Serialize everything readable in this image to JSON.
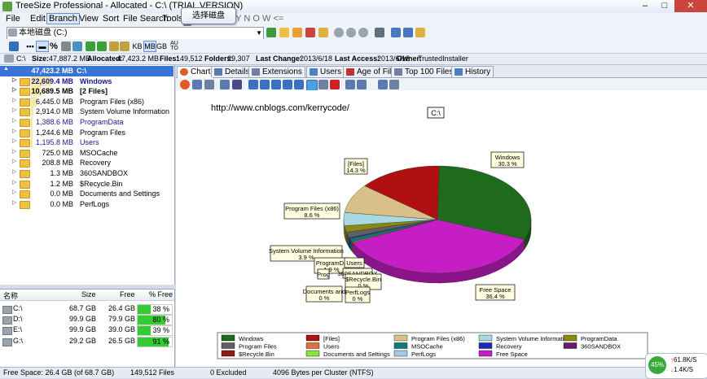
{
  "window": {
    "title": "TreeSize Professional - Allocated - C:\\  (TRIAL VERSION)",
    "controls": [
      "–",
      "□",
      "✕"
    ]
  },
  "menu": [
    "File",
    "Edit",
    "Branch",
    "View",
    "Sort",
    "File Search",
    "Tools",
    "B U Y   N O W <="
  ],
  "tooltip": "选择磁盘",
  "drive_select": {
    "value": "本地磁盘 (C:)"
  },
  "toolbar": {
    "kb": "KB",
    "mb": "MB",
    "gb": "GB",
    "auto": "AU TO",
    "pct": "%"
  },
  "infobar": {
    "path": "C:\\",
    "size_label": "Size:",
    "size": "47,887.2 MB",
    "alloc_label": "Allocated:",
    "alloc": "47,423.2 MB",
    "files_label": "Files:",
    "files": "149,512",
    "folders_label": "Folders:",
    "folders": "29,307",
    "lastchange_label": "Last Change:",
    "lastchange": "2013/6/18",
    "lastaccess_label": "Last Access:",
    "lastaccess": "2013/6/18",
    "owner_label": "Owner:",
    "owner": "TrustedInstaller"
  },
  "tree": {
    "root": {
      "size": "47,423.2 MB",
      "name": "C:\\"
    },
    "items": [
      {
        "size": "22,609.4 MB",
        "name": "Windows",
        "bold": true,
        "pct": 0.48,
        "color": "#1a1a8c"
      },
      {
        "size": "10,689.5 MB",
        "name": "[2 Files]",
        "bold": true,
        "pct": 0.23,
        "color": "#000000"
      },
      {
        "size": "6,445.0 MB",
        "name": "Program Files (x86)",
        "bold": false,
        "pct": 0.14,
        "color": "#000000"
      },
      {
        "size": "2,914.0 MB",
        "name": "System Volume Information",
        "bold": false,
        "pct": 0.06,
        "color": "#000000"
      },
      {
        "size": "1,388.6 MB",
        "name": "ProgramData",
        "bold": false,
        "pct": 0.03,
        "color": "#1a1a8c"
      },
      {
        "size": "1,244.6 MB",
        "name": "Program Files",
        "bold": false,
        "pct": 0.03,
        "color": "#000000"
      },
      {
        "size": "1,195.8 MB",
        "name": "Users",
        "bold": false,
        "pct": 0.03,
        "color": "#1a1a8c"
      },
      {
        "size": "725.0 MB",
        "name": "MSOCache",
        "bold": false,
        "pct": 0.0,
        "color": "#000000"
      },
      {
        "size": "208.8 MB",
        "name": "Recovery",
        "bold": false,
        "pct": 0.0,
        "color": "#000000"
      },
      {
        "size": "1.3 MB",
        "name": "360SANDBOX",
        "bold": false,
        "pct": 0.0,
        "color": "#000000"
      },
      {
        "size": "1.2 MB",
        "name": "$Recycle.Bin",
        "bold": false,
        "pct": 0.0,
        "color": "#000000"
      },
      {
        "size": "0.0 MB",
        "name": "Documents and Settings",
        "bold": false,
        "pct": 0.0,
        "color": "#000000"
      },
      {
        "size": "0.0 MB",
        "name": "PerfLogs",
        "bold": false,
        "pct": 0.0,
        "color": "#000000"
      }
    ]
  },
  "drivelist": {
    "headers": [
      "名称",
      "Size",
      "Free",
      "% Free"
    ],
    "rows": [
      {
        "name": "C:\\",
        "size": "68.7 GB",
        "free": "26.4 GB",
        "pct": "38 %",
        "fill": 0.38
      },
      {
        "name": "D:\\",
        "size": "99.9 GB",
        "free": "79.9 GB",
        "pct": "80 %",
        "fill": 0.8
      },
      {
        "name": "E:\\",
        "size": "99.9 GB",
        "free": "39.0 GB",
        "pct": "39 %",
        "fill": 0.39
      },
      {
        "name": "G:\\",
        "size": "29.2 GB",
        "free": "26.5 GB",
        "pct": "91 %",
        "fill": 0.91
      }
    ]
  },
  "tabs": [
    "Chart",
    "Details",
    "Extensions",
    "Users",
    "Age of Files",
    "Top 100 Files",
    "History"
  ],
  "chart_data": {
    "type": "pie",
    "url_text": "http://www.cnblogs.com/kerrycode/",
    "title": "C:\\",
    "slices": [
      {
        "name": "Windows",
        "value": 30.3,
        "label": "30.3 %",
        "color": "#1e6b1e"
      },
      {
        "name": "Free Space",
        "value": 36.4,
        "label": "36.4 %",
        "color": "#c41ec4"
      },
      {
        "name": "PerfLogs",
        "value": 0.0,
        "label": "0 %",
        "color": "#a8c8e8"
      },
      {
        "name": "Documents and Settings",
        "value": 0.0,
        "label": "0 %",
        "color": "#90e040"
      },
      {
        "name": "$Recycle.Bin",
        "value": 0.0,
        "label": "0 %",
        "color": "#8b1a1a"
      },
      {
        "name": "360SANDBOX",
        "value": 0.0,
        "label": "",
        "color": "#6a1a6a"
      },
      {
        "name": "Users",
        "value": 0.3,
        "label": "",
        "color": "#e07040"
      },
      {
        "name": "MSOCache",
        "value": 1.0,
        "label": "",
        "color": "#107878"
      },
      {
        "name": "Recovery",
        "value": 0.3,
        "label": "",
        "color": "#1a2ab4"
      },
      {
        "name": "Program Files",
        "value": 1.7,
        "label": "",
        "color": "#606060"
      },
      {
        "name": "ProgramData",
        "value": 1.9,
        "label": "",
        "color": "#8a8a10"
      },
      {
        "name": "System Volume Information",
        "value": 3.9,
        "label": "3.9 %",
        "color": "#a8d8e0"
      },
      {
        "name": "Program Files (x86)",
        "value": 8.6,
        "label": "8.6 %",
        "color": "#d8c088"
      },
      {
        "name": "[Files]",
        "value": 14.3,
        "label": "14.3 %",
        "color": "#b01010"
      }
    ],
    "callouts": [
      {
        "text": "Windows",
        "pct": "30.3 %"
      },
      {
        "text": "[Files]",
        "pct": "14.3 %"
      },
      {
        "text": "Program Files (x86)",
        "pct": "8.6 %"
      },
      {
        "text": "System Volume Information",
        "pct": "3.9 %"
      },
      {
        "text": "ProgramDa",
        "pct": "1.9 %"
      },
      {
        "text": "Prog",
        "pct": ""
      },
      {
        "text": "Users",
        "pct": ""
      },
      {
        "text": "360SANDBOX",
        "pct": ""
      },
      {
        "text": "$Recycle.Bin",
        "pct": "0 %"
      },
      {
        "text": "Documents and",
        "pct": "0 %"
      },
      {
        "text": "PerfLogs",
        "pct": "0 %"
      },
      {
        "text": "Free Space",
        "pct": "36.4 %"
      }
    ],
    "legend": [
      {
        "name": "Windows",
        "color": "#1e6b1e"
      },
      {
        "name": "[Files]",
        "color": "#b01010"
      },
      {
        "name": "Program Files (x86)",
        "color": "#d8c088"
      },
      {
        "name": "System Volume Information",
        "color": "#a8d8e0"
      },
      {
        "name": "ProgramData",
        "color": "#8a8a10"
      },
      {
        "name": "Program Files",
        "color": "#606060"
      },
      {
        "name": "Users",
        "color": "#e07040"
      },
      {
        "name": "MSOCache",
        "color": "#107878"
      },
      {
        "name": "Recovery",
        "color": "#1a2ab4"
      },
      {
        "name": "360SANDBOX",
        "color": "#6a1a6a"
      },
      {
        "name": "$Recycle.Bin",
        "color": "#8b1a1a"
      },
      {
        "name": "Documents and Settings",
        "color": "#90e040"
      },
      {
        "name": "PerfLogs",
        "color": "#a8c8e8"
      },
      {
        "name": "Free Space",
        "color": "#c41ec4"
      }
    ]
  },
  "statusbar": {
    "free": "Free Space: 26.4 GB  (of 68.7 GB)",
    "files": "149,512  Files",
    "excluded": "0 Excluded",
    "cluster": "4096 Bytes per Cluster (NTFS)"
  },
  "netwidget": {
    "pct": "45%",
    "up": "61.8K/S",
    "down": "1.4K/S"
  }
}
